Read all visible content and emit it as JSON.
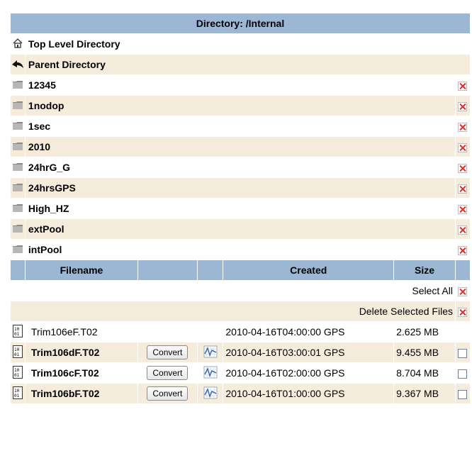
{
  "header": {
    "title": "Directory: /Internal"
  },
  "nav": {
    "top": {
      "label": "Top Level Directory",
      "icon": "home-icon"
    },
    "parent": {
      "label": "Parent Directory",
      "icon": "back-arrow-icon"
    }
  },
  "folders": [
    {
      "name": "12345"
    },
    {
      "name": "1nodop"
    },
    {
      "name": "1sec"
    },
    {
      "name": "2010"
    },
    {
      "name": "24hrG_G"
    },
    {
      "name": "24hrsGPS"
    },
    {
      "name": "High_HZ"
    },
    {
      "name": "extPool"
    },
    {
      "name": "intPool"
    }
  ],
  "columns": {
    "filename": "Filename",
    "created": "Created",
    "size": "Size"
  },
  "actions": {
    "select_all": "Select All",
    "delete_selected": "Delete Selected Files"
  },
  "files": [
    {
      "name": "Trim106eF.T02",
      "created": "2010-04-16T04:00:00 GPS",
      "size": "2.625 MB",
      "convert": ""
    },
    {
      "name": "Trim106dF.T02",
      "created": "2010-04-16T03:00:01 GPS",
      "size": "9.455 MB",
      "convert": "Convert"
    },
    {
      "name": "Trim106cF.T02",
      "created": "2010-04-16T02:00:00 GPS",
      "size": "8.704 MB",
      "convert": "Convert"
    },
    {
      "name": "Trim106bF.T02",
      "created": "2010-04-16T01:00:00 GPS",
      "size": "9.367 MB",
      "convert": "Convert"
    }
  ],
  "colors": {
    "header": "#9bb7d4",
    "row_alt": "#f6ecdc",
    "delete_x": "#e0302a"
  }
}
